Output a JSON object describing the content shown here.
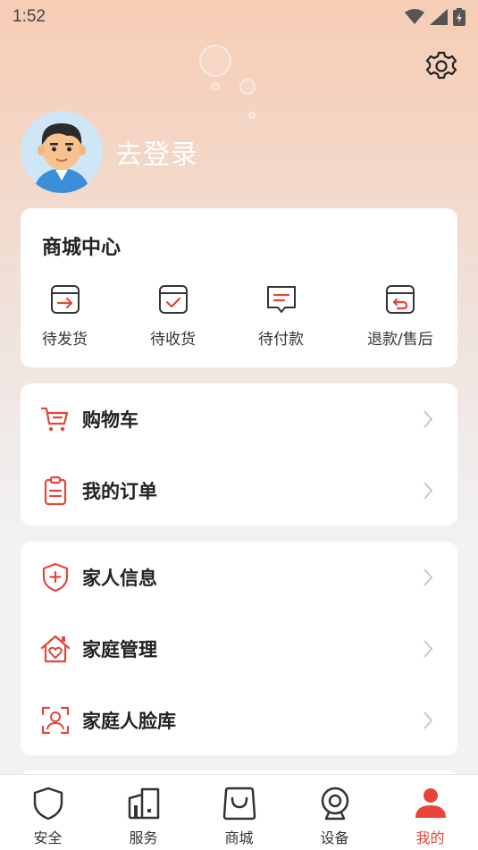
{
  "status_bar": {
    "time": "1:52"
  },
  "profile": {
    "login_text": "去登录"
  },
  "mall_center": {
    "title": "商城中心",
    "orders": [
      {
        "label": "待发货",
        "icon": "box-arrow-icon"
      },
      {
        "label": "待收货",
        "icon": "box-check-icon"
      },
      {
        "label": "待付款",
        "icon": "chat-lines-icon"
      },
      {
        "label": "退款/售后",
        "icon": "box-return-icon"
      }
    ]
  },
  "shop_list": [
    {
      "label": "购物车",
      "icon": "cart-icon"
    },
    {
      "label": "我的订单",
      "icon": "clipboard-icon"
    }
  ],
  "family_list": [
    {
      "label": "家人信息",
      "icon": "shield-plus-icon"
    },
    {
      "label": "家庭管理",
      "icon": "home-heart-icon"
    },
    {
      "label": "家庭人脸库",
      "icon": "face-scan-icon"
    }
  ],
  "tabbar": [
    {
      "label": "安全",
      "icon": "shield-icon"
    },
    {
      "label": "服务",
      "icon": "building-icon"
    },
    {
      "label": "商城",
      "icon": "shopping-bag-icon"
    },
    {
      "label": "设备",
      "icon": "webcam-icon"
    },
    {
      "label": "我的",
      "icon": "person-icon",
      "active": true
    }
  ],
  "colors": {
    "accent": "#e8443a",
    "icon_red": "#e0483e",
    "chevron": "#c8c8c8"
  }
}
